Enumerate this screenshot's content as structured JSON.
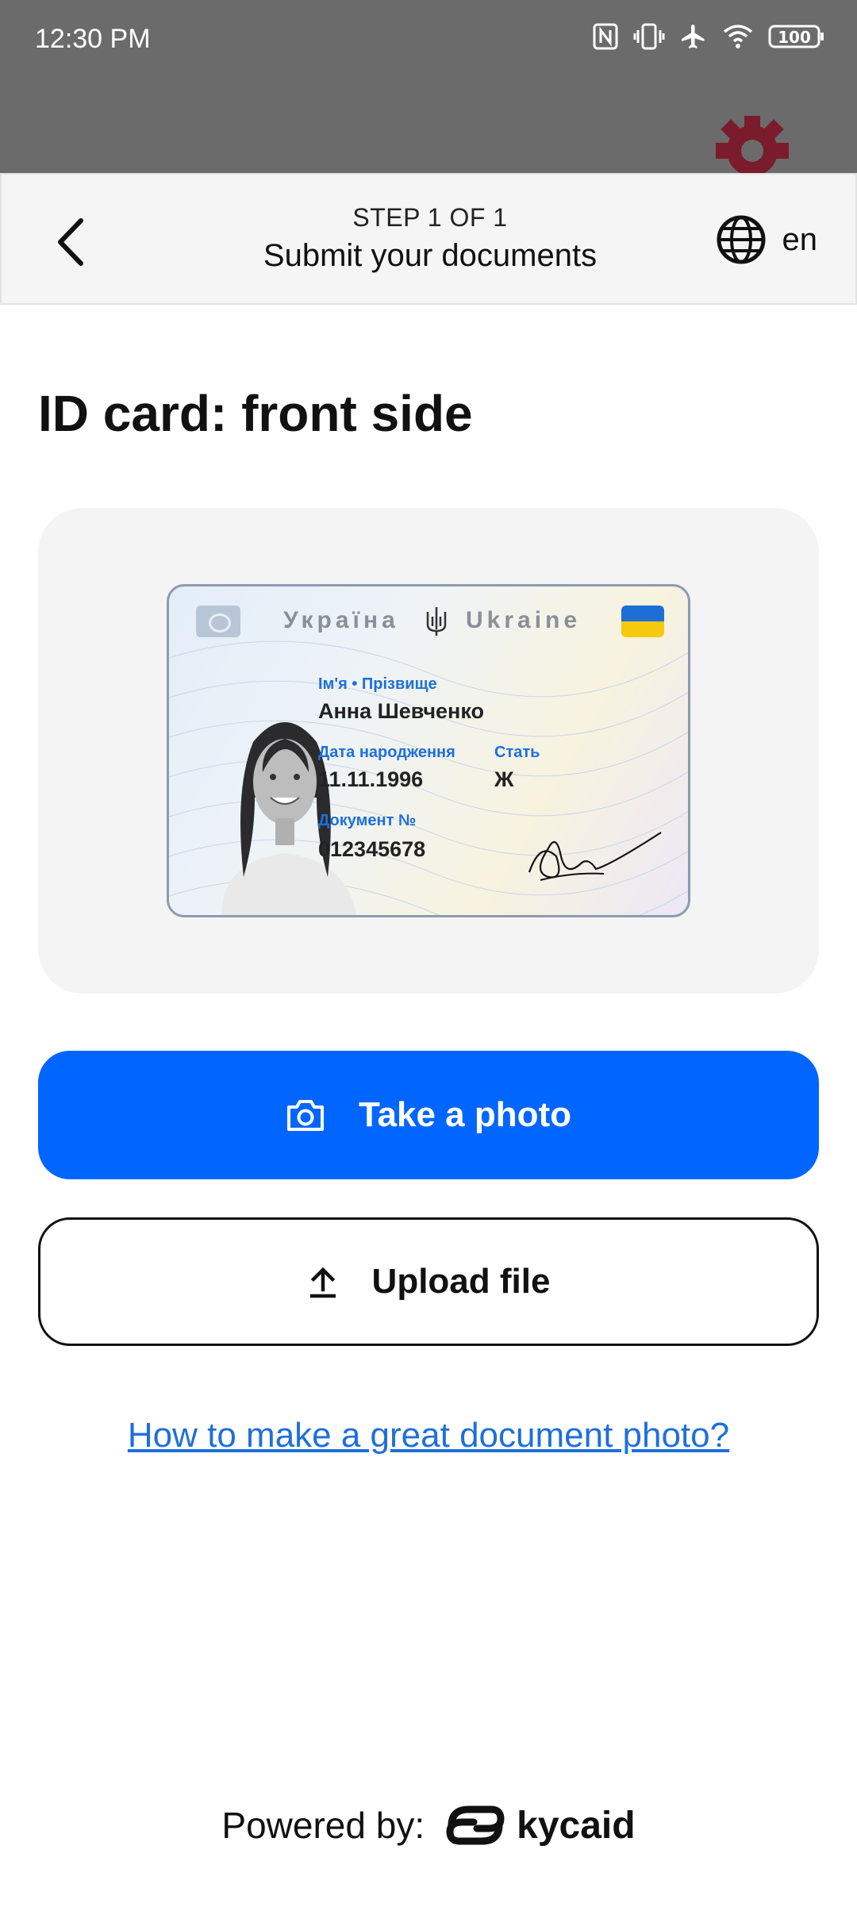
{
  "status_bar": {
    "time": "12:30 PM",
    "battery": "100"
  },
  "header": {
    "step": "STEP 1 OF 1",
    "title": "Submit your documents",
    "language": "en"
  },
  "main": {
    "title": "ID card: front side",
    "id_card": {
      "country_ua": "Україна",
      "country_en": "Ukraine",
      "name_label": "Ім'я • Прізвище",
      "name_value": "Анна Шевченко",
      "dob_label": "Дата народження",
      "dob_value": "11.11.1996",
      "sex_label": "Стать",
      "sex_value": "Ж",
      "doc_label": "Документ №",
      "doc_value": "012345678"
    },
    "take_photo_label": "Take a photo",
    "upload_label": "Upload file",
    "help_link": "How to make a great document photo?"
  },
  "footer": {
    "powered_by": "Powered by:",
    "brand": "kycaid"
  },
  "colors": {
    "primary": "#0066ff",
    "link": "#1f6fdb",
    "status_bar": "#6b6b6b",
    "header_bg": "#f5f5f5",
    "panel_bg": "#f4f4f4"
  }
}
